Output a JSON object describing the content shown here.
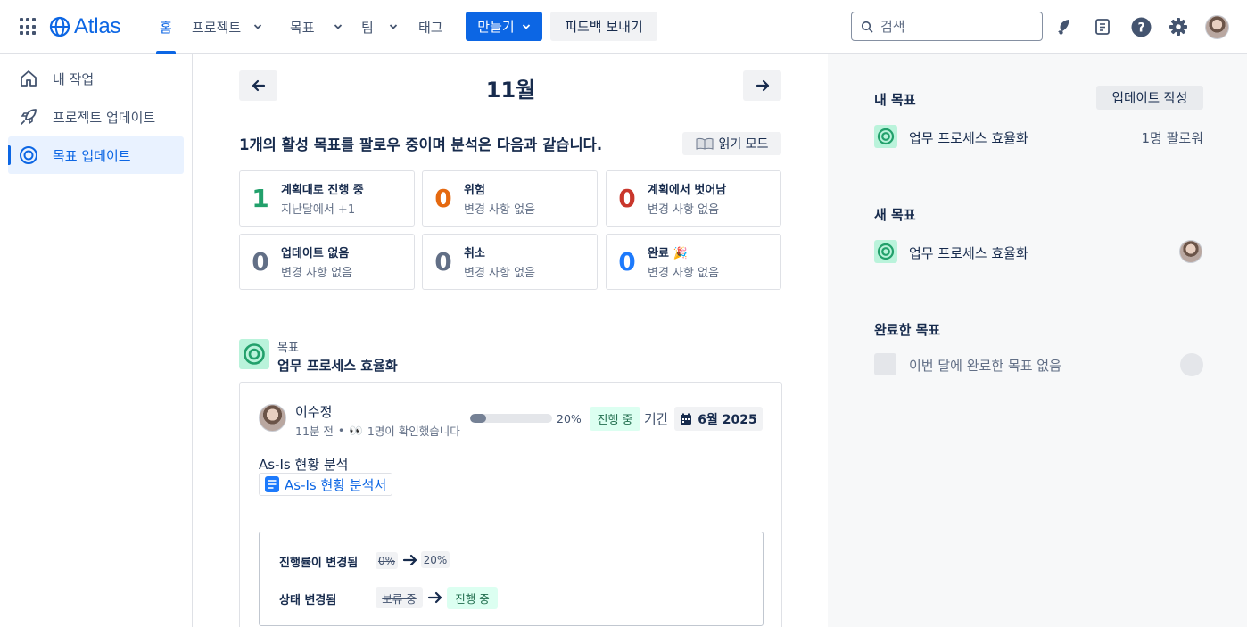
{
  "nav": {
    "brand": "Atlas",
    "items": [
      {
        "label": "홈",
        "active": true
      },
      {
        "label": "프로젝트"
      },
      {
        "label": "목표"
      },
      {
        "label": "팀"
      },
      {
        "label": "태그"
      }
    ],
    "create_label": "만들기",
    "feedback_label": "피드백 보내기",
    "search_placeholder": "검색",
    "icons": [
      "app-switcher-icon",
      "notification-icon",
      "whats-new-icon",
      "help-icon",
      "settings-icon",
      "profile-avatar"
    ]
  },
  "sidebar": {
    "items": [
      {
        "label": "내 작업",
        "icon": "home-icon"
      },
      {
        "label": "프로젝트 업데이트",
        "icon": "rocket-icon"
      },
      {
        "label": "목표 업데이트",
        "icon": "goal-icon",
        "active": true
      }
    ]
  },
  "main": {
    "month": "11월",
    "summary": "1개의 활성 목표를 팔로우 중이며 분석은 다음과 같습니다.",
    "read_mode": "읽기 모드",
    "stats": [
      {
        "num": "1",
        "title": "계획대로 진행 중",
        "sub": "지난달에서 +1",
        "color": "#22a06b"
      },
      {
        "num": "0",
        "title": "위험",
        "sub": "변경 사항 없음",
        "color": "#e56910"
      },
      {
        "num": "0",
        "title": "계획에서 벗어남",
        "sub": "변경 사항 없음",
        "color": "#c9372c"
      },
      {
        "num": "0",
        "title": "업데이트 없음",
        "sub": "변경 사항 없음",
        "color": "#626f86"
      },
      {
        "num": "0",
        "title": "취소",
        "sub": "변경 사항 없음",
        "color": "#626f86"
      },
      {
        "num": "0",
        "title": "완료 🎉",
        "sub": "변경 사항 없음",
        "color": "#1d7afc"
      }
    ],
    "goal": {
      "kicker": "목표",
      "name": "업무 프로세스 효율화"
    },
    "update": {
      "author": "이수정",
      "time": "11분 전",
      "separator": "•",
      "seen_emoji": "👀",
      "seen": "1명이 확인했습니다",
      "progress": 0.2,
      "progress_label": "20%",
      "status": "진행 중",
      "due_label": "기간",
      "due": "6월 2025",
      "text": "As-Is 현황 분석",
      "link": "As-Is 현황 분석서",
      "changes": [
        {
          "label": "진행률이 변경됨",
          "old": "0%",
          "new": "20%"
        },
        {
          "label": "상태 변경됨",
          "old": "보류 중",
          "new": "진행 중"
        }
      ]
    }
  },
  "right": {
    "my_goals": {
      "heading": "내 목표",
      "button": "업데이트 작성",
      "goal": "업무 프로세스 효율화",
      "followers": "1명 팔로워"
    },
    "new_goals": {
      "heading": "새 목표",
      "goal": "업무 프로세스 효율화"
    },
    "done_goals": {
      "heading": "완료한 목표",
      "empty": "이번 달에 완료한 목표 없음"
    }
  },
  "colors": {
    "accent": "#0c66e4",
    "goal_green": "#22a06b",
    "status_bg": "#dcfff1"
  }
}
